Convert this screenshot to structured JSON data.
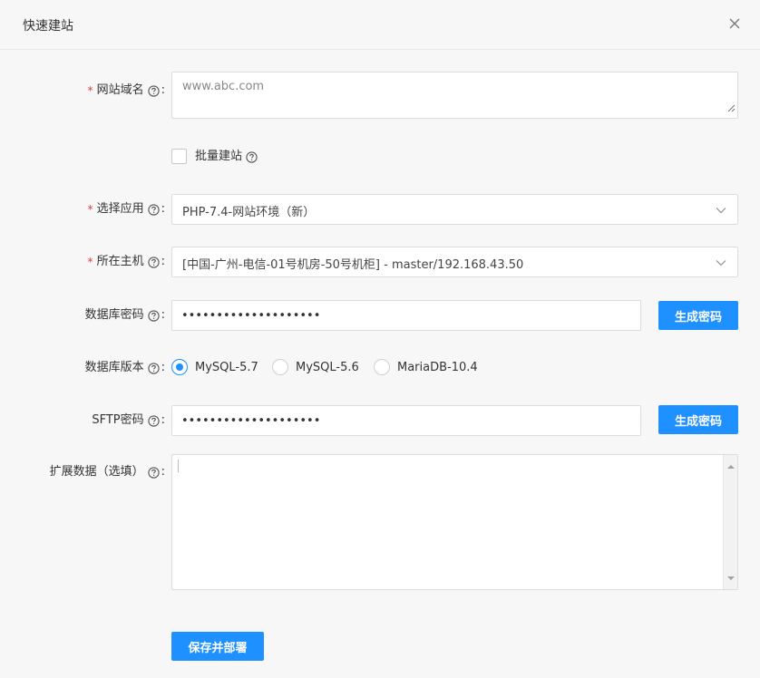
{
  "dialog": {
    "title": "快速建站"
  },
  "form": {
    "domain": {
      "label": "网站域名",
      "placeholder": "www.abc.com",
      "required": true
    },
    "batch": {
      "label": "批量建站",
      "checked": false
    },
    "app": {
      "label": "选择应用",
      "value": "PHP-7.4-网站环境（新）",
      "required": true
    },
    "host": {
      "label": "所在主机",
      "value": "[中国-广州-电信-01号机房-50号机柜] - master/192.168.43.50",
      "required": true
    },
    "db_password": {
      "label": "数据库密码",
      "value": "••••••••••••••••••••",
      "button": "生成密码"
    },
    "db_version": {
      "label": "数据库版本",
      "options": [
        "MySQL-5.7",
        "MySQL-5.6",
        "MariaDB-10.4"
      ],
      "selected": "MySQL-5.7"
    },
    "sftp_password": {
      "label": "SFTP密码",
      "value": "••••••••••••••••••••",
      "button": "生成密码"
    },
    "extra": {
      "label": "扩展数据（选填）"
    },
    "required_mark": "*",
    "colon": ":",
    "submit": "保存并部署"
  },
  "icons": {
    "help": "question-circle-icon",
    "close": "close-icon",
    "dropdown": "chevron-down-icon"
  },
  "colors": {
    "accent": "#1e90ff",
    "required": "#e53935"
  }
}
